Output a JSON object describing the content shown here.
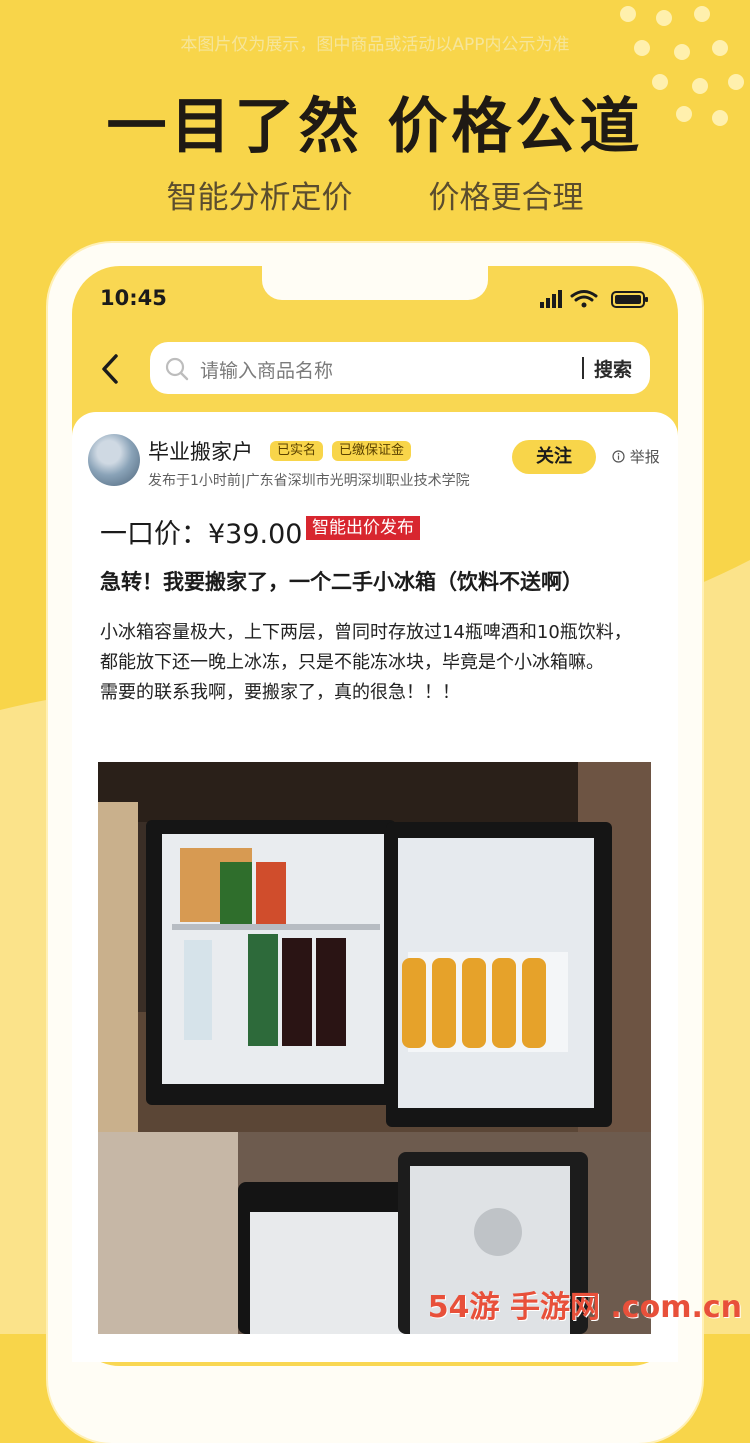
{
  "promo": {
    "disclaimer": "本图片仅为展示，图中商品或活动以APP内公示为准",
    "headline": "一目了然 价格公道",
    "sub_left": "智能分析定价",
    "sub_right": "价格更合理"
  },
  "status_bar": {
    "time": "10:45"
  },
  "search": {
    "placeholder": "请输入商品名称",
    "button_label": "搜索"
  },
  "post": {
    "username": "毕业搬家户",
    "badge_verified": "已实名",
    "badge_deposit": "已缴保证金",
    "meta": "发布于1小时前|广东省深圳市光明深圳职业技术学院",
    "follow_label": "关注",
    "report_label": "举报",
    "price": "一口价：¥39.00",
    "price_tag": "智能出价发布",
    "title": "急转！我要搬家了，一个二手小冰箱（饮料不送啊）",
    "desc_1": "小冰箱容量极大，上下两层，曾同时存放过14瓶啤酒和10瓶饮料，都能放下还一晚上冰冻，只是不能冻冰块，毕竟是个小冰箱嘛。",
    "desc_2": "需要的联系我啊，要搬家了，真的很急！！！"
  },
  "watermark": "54游 手游网 .com.cn",
  "colors": {
    "brand_yellow": "#f8d54a",
    "price_tag_red": "#d8262f"
  }
}
